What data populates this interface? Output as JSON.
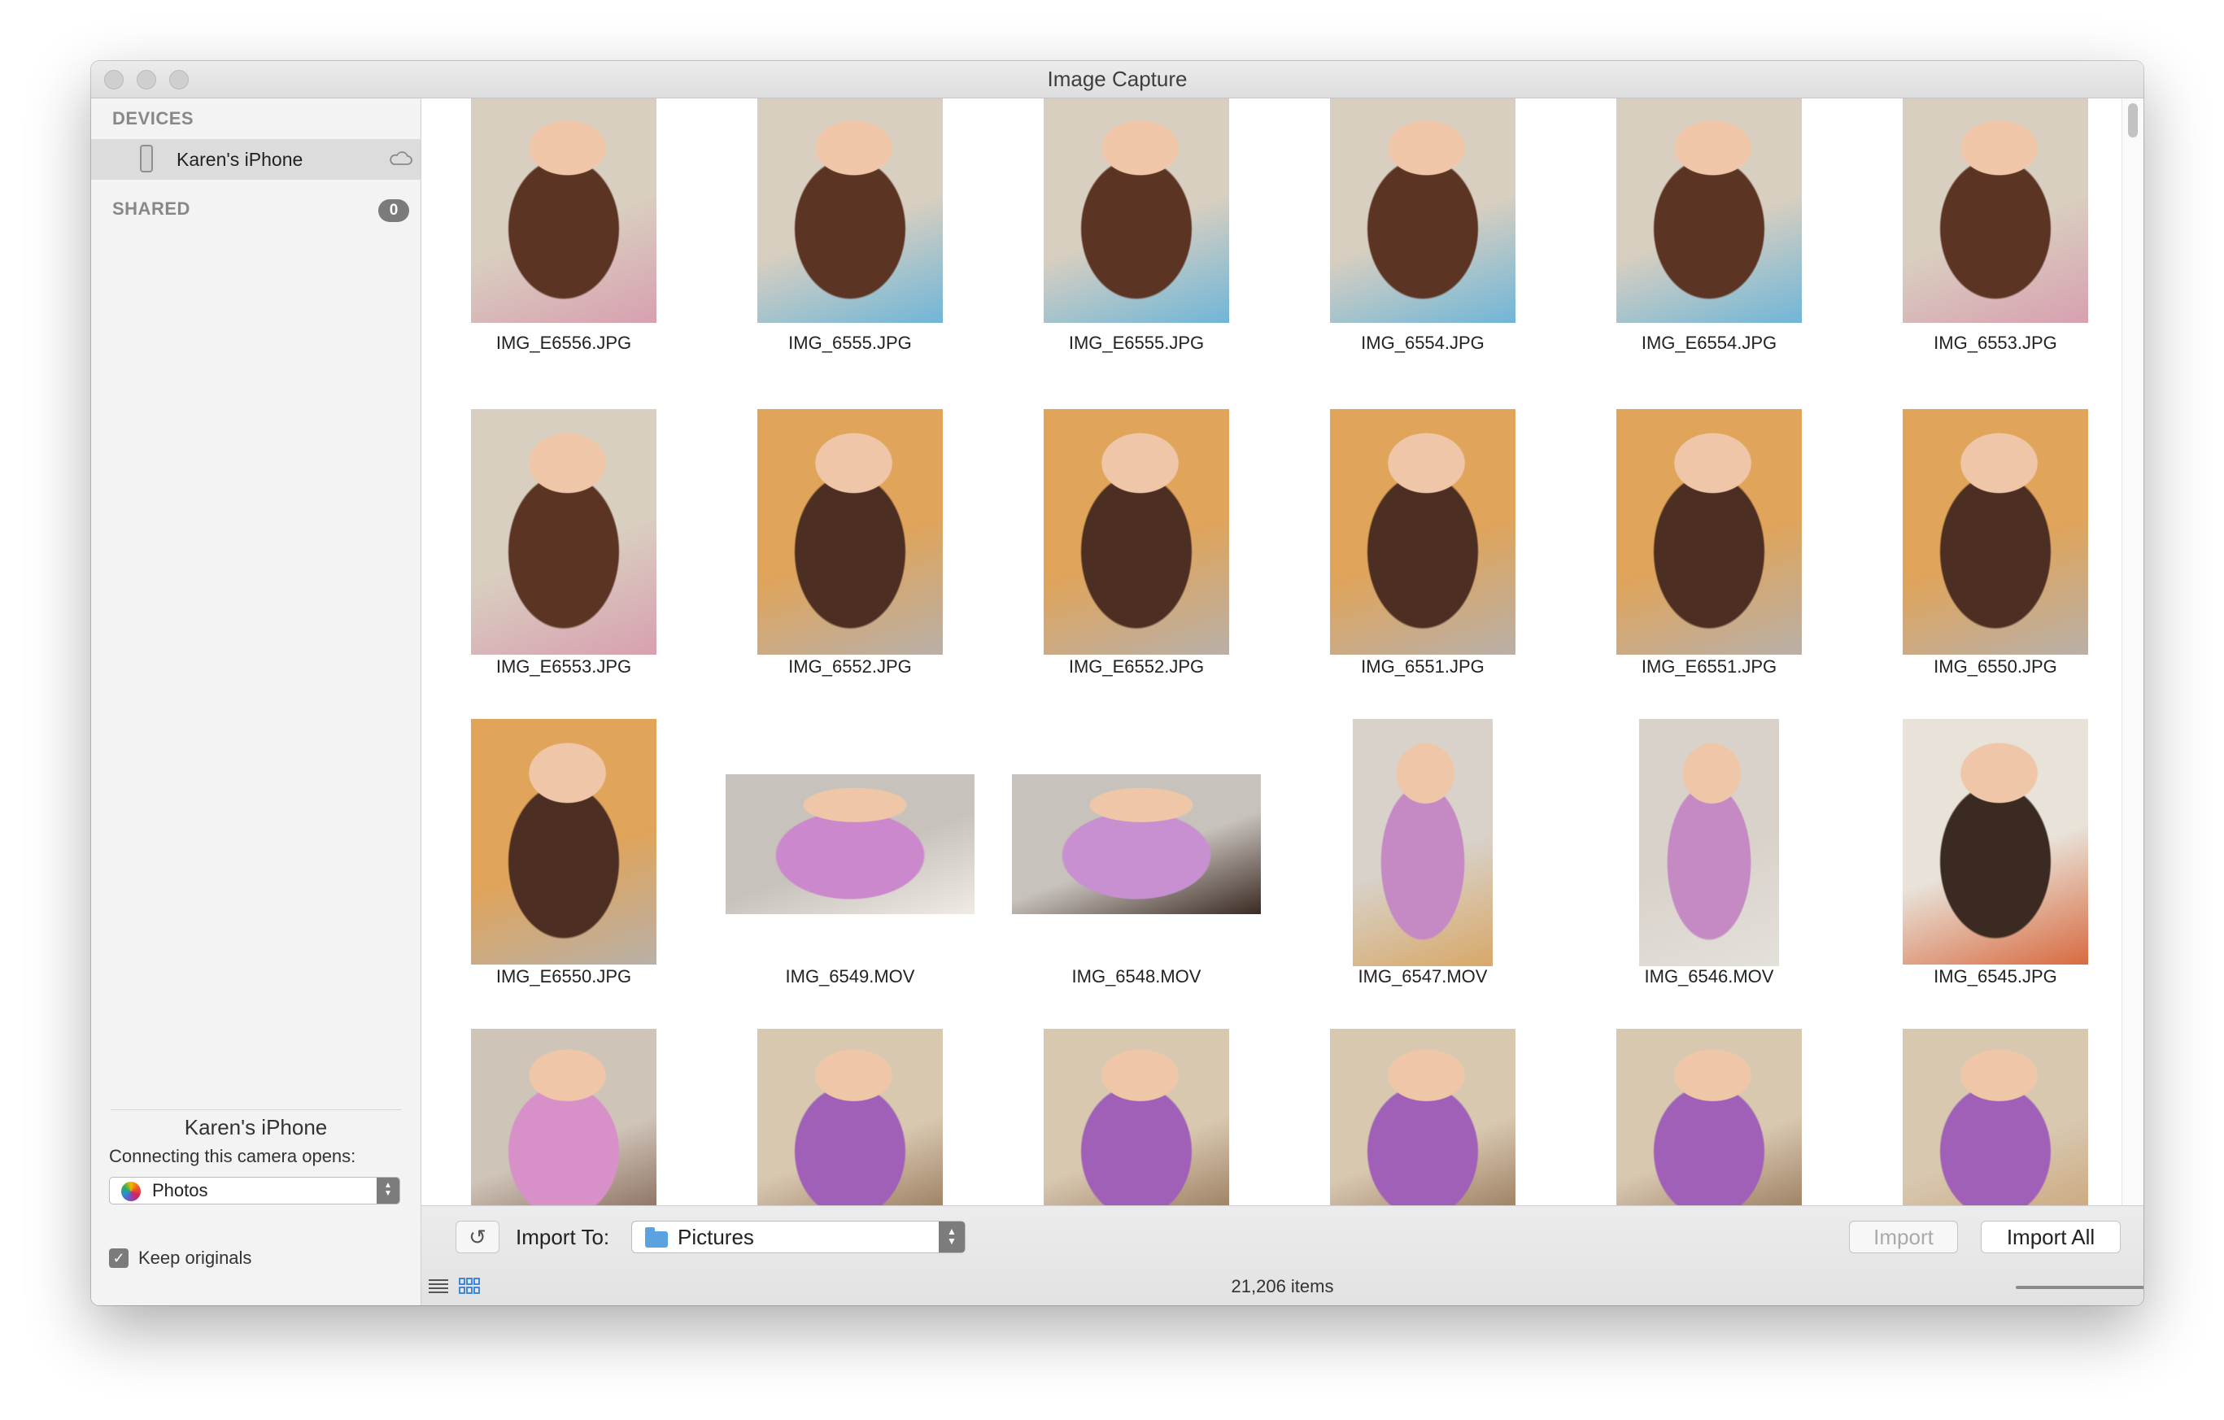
{
  "window": {
    "title": "Image Capture"
  },
  "sidebar": {
    "devices_heading": "DEVICES",
    "device": {
      "name": "Karen's iPhone",
      "icon": "iphone-icon",
      "status_icon": "cloud-icon"
    },
    "shared_heading": "SHARED",
    "shared_count": "0",
    "device_title": "Karen's iPhone",
    "opens_label": "Connecting this camera opens:",
    "opens_app": "Photos",
    "keep_originals_label": "Keep originals",
    "keep_originals_checked": true
  },
  "thumbnails": [
    {
      "name": "IMG_E6556.JPG",
      "kind": "photo",
      "colors": [
        "#5b3424",
        "#d9cfc0",
        "#d8a0b0"
      ]
    },
    {
      "name": "IMG_6555.JPG",
      "kind": "photo",
      "colors": [
        "#5b3424",
        "#d9cfc0",
        "#6fb6d8"
      ]
    },
    {
      "name": "IMG_E6555.JPG",
      "kind": "photo",
      "colors": [
        "#5b3424",
        "#d9cfc0",
        "#6fb6d8"
      ]
    },
    {
      "name": "IMG_6554.JPG",
      "kind": "photo",
      "colors": [
        "#5b3424",
        "#d9cfc0",
        "#6fb6d8"
      ]
    },
    {
      "name": "IMG_E6554.JPG",
      "kind": "photo",
      "colors": [
        "#5b3424",
        "#d9cfc0",
        "#6fb6d8"
      ]
    },
    {
      "name": "IMG_6553.JPG",
      "kind": "photo",
      "colors": [
        "#5b3424",
        "#d9cfc0",
        "#d8a0b0"
      ]
    },
    {
      "name": "IMG_E6553.JPG",
      "kind": "photo",
      "colors": [
        "#5b3424",
        "#d9cfc0",
        "#d8a0b0"
      ]
    },
    {
      "name": "IMG_6552.JPG",
      "kind": "photo",
      "colors": [
        "#4c2e22",
        "#e0a45a",
        "#b8b0a8"
      ]
    },
    {
      "name": "IMG_E6552.JPG",
      "kind": "photo",
      "colors": [
        "#4c2e22",
        "#e0a45a",
        "#b8b0a8"
      ]
    },
    {
      "name": "IMG_6551.JPG",
      "kind": "photo",
      "colors": [
        "#4c2e22",
        "#e0a45a",
        "#b8b0a8"
      ]
    },
    {
      "name": "IMG_E6551.JPG",
      "kind": "photo",
      "colors": [
        "#4c2e22",
        "#e0a45a",
        "#b8b0a8"
      ]
    },
    {
      "name": "IMG_6550.JPG",
      "kind": "photo",
      "colors": [
        "#4c2e22",
        "#e0a45a",
        "#b8b0a8"
      ]
    },
    {
      "name": "IMG_E6550.JPG",
      "kind": "photo",
      "colors": [
        "#4c2e22",
        "#e0a45a",
        "#b8b0a8"
      ]
    },
    {
      "name": "IMG_6549.MOV",
      "kind": "video-landscape",
      "colors": [
        "#cc88cc",
        "#c8c2bc",
        "#efeae4"
      ]
    },
    {
      "name": "IMG_6548.MOV",
      "kind": "video-landscape",
      "colors": [
        "#c890d0",
        "#c8c2bc",
        "#3a2a22"
      ]
    },
    {
      "name": "IMG_6547.MOV",
      "kind": "video-portrait",
      "colors": [
        "#c58ac4",
        "#d8d2ca",
        "#d8a868"
      ]
    },
    {
      "name": "IMG_6546.MOV",
      "kind": "video-portrait",
      "colors": [
        "#c58ac4",
        "#d8d2ca",
        "#e4e0da"
      ]
    },
    {
      "name": "IMG_6545.JPG",
      "kind": "photo",
      "colors": [
        "#3a2a22",
        "#e8e2d8",
        "#d86a40"
      ]
    },
    {
      "name": "",
      "kind": "photo-partial",
      "colors": [
        "#d890c8",
        "#cfc4b8",
        "#7a5a48"
      ]
    },
    {
      "name": "",
      "kind": "photo-partial",
      "colors": [
        "#a060b8",
        "#d8c8b0",
        "#8c6a4c"
      ]
    },
    {
      "name": "",
      "kind": "photo-partial",
      "colors": [
        "#a060b8",
        "#d8c8b0",
        "#8c6a4c"
      ]
    },
    {
      "name": "",
      "kind": "photo-partial",
      "colors": [
        "#a060b8",
        "#d8c8b0",
        "#8c6a4c"
      ]
    },
    {
      "name": "",
      "kind": "photo-partial",
      "colors": [
        "#a060b8",
        "#d8c8b0",
        "#8c6a4c"
      ]
    },
    {
      "name": "",
      "kind": "photo-partial",
      "colors": [
        "#a060b8",
        "#d8c8b0",
        "#c8a070"
      ]
    }
  ],
  "bottombar": {
    "rotate_icon": "rotate-icon",
    "import_to_label": "Import To:",
    "destination": "Pictures",
    "import_button": "Import",
    "import_all_button": "Import All",
    "items_count": "21,206 items",
    "thumbnail_size": 1.0
  }
}
